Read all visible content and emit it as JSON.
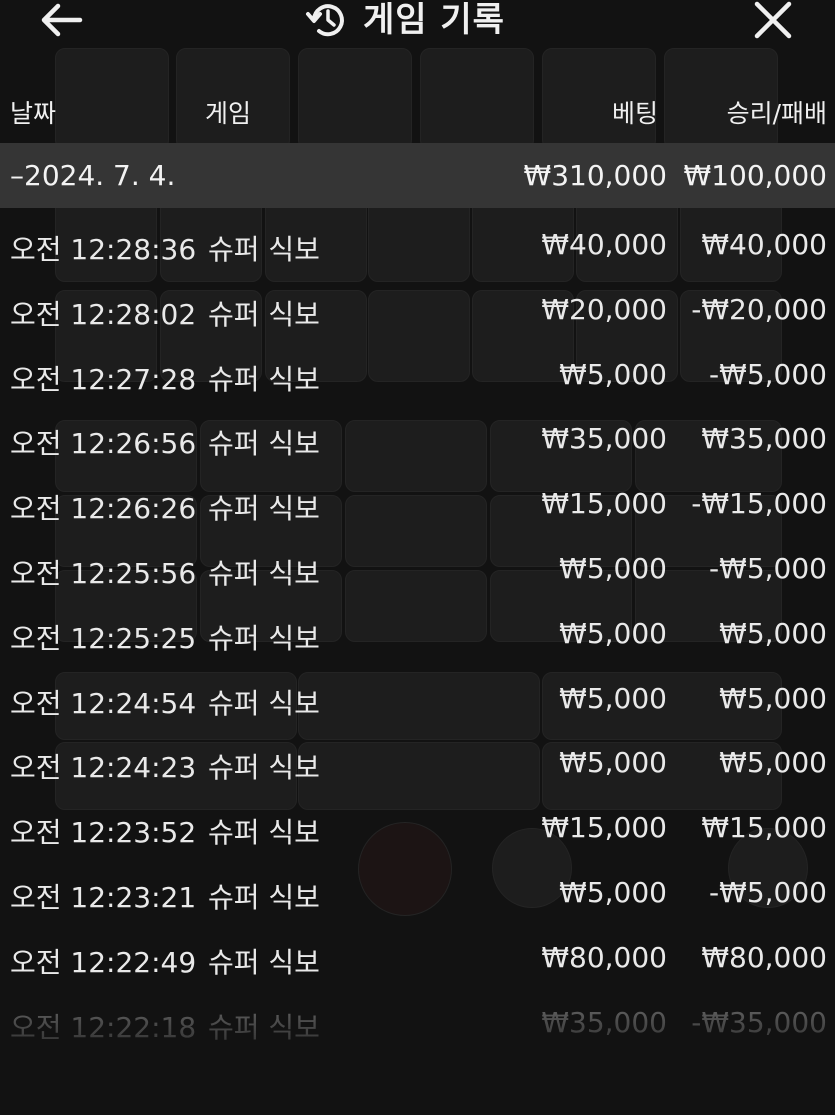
{
  "header": {
    "title": "게임 기록",
    "back_icon": "arrow-left-icon",
    "history_icon": "history-icon",
    "close_icon": "close-icon"
  },
  "columns": {
    "date": "날짜",
    "game": "게임",
    "bet": "베팅",
    "result": "승리/패배"
  },
  "group": {
    "date": "–2024. 7. 4.",
    "bet_total": "₩310,000",
    "result_total": "₩100,000"
  },
  "rows": [
    {
      "time": "오전 12:28:36",
      "game": "슈퍼 식보",
      "bet": "₩40,000",
      "result": "₩40,000"
    },
    {
      "time": "오전 12:28:02",
      "game": "슈퍼 식보",
      "bet": "₩20,000",
      "result": "-₩20,000"
    },
    {
      "time": "오전 12:27:28",
      "game": "슈퍼 식보",
      "bet": "₩5,000",
      "result": "-₩5,000"
    },
    {
      "time": "오전 12:26:56",
      "game": "슈퍼 식보",
      "bet": "₩35,000",
      "result": "₩35,000"
    },
    {
      "time": "오전 12:26:26",
      "game": "슈퍼 식보",
      "bet": "₩15,000",
      "result": "-₩15,000"
    },
    {
      "time": "오전 12:25:56",
      "game": "슈퍼 식보",
      "bet": "₩5,000",
      "result": "-₩5,000"
    },
    {
      "time": "오전 12:25:25",
      "game": "슈퍼 식보",
      "bet": "₩5,000",
      "result": "₩5,000"
    },
    {
      "time": "오전 12:24:54",
      "game": "슈퍼 식보",
      "bet": "₩5,000",
      "result": "₩5,000"
    },
    {
      "time": "오전 12:24:23",
      "game": "슈퍼 식보",
      "bet": "₩5,000",
      "result": "₩5,000"
    },
    {
      "time": "오전 12:23:52",
      "game": "슈퍼 식보",
      "bet": "₩15,000",
      "result": "₩15,000"
    },
    {
      "time": "오전 12:23:21",
      "game": "슈퍼 식보",
      "bet": "₩5,000",
      "result": "-₩5,000"
    },
    {
      "time": "오전 12:22:49",
      "game": "슈퍼 식보",
      "bet": "₩80,000",
      "result": "₩80,000"
    },
    {
      "time": "오전 12:22:18",
      "game": "슈퍼 식보",
      "bet": "₩35,000",
      "result": "-₩35,000"
    }
  ]
}
